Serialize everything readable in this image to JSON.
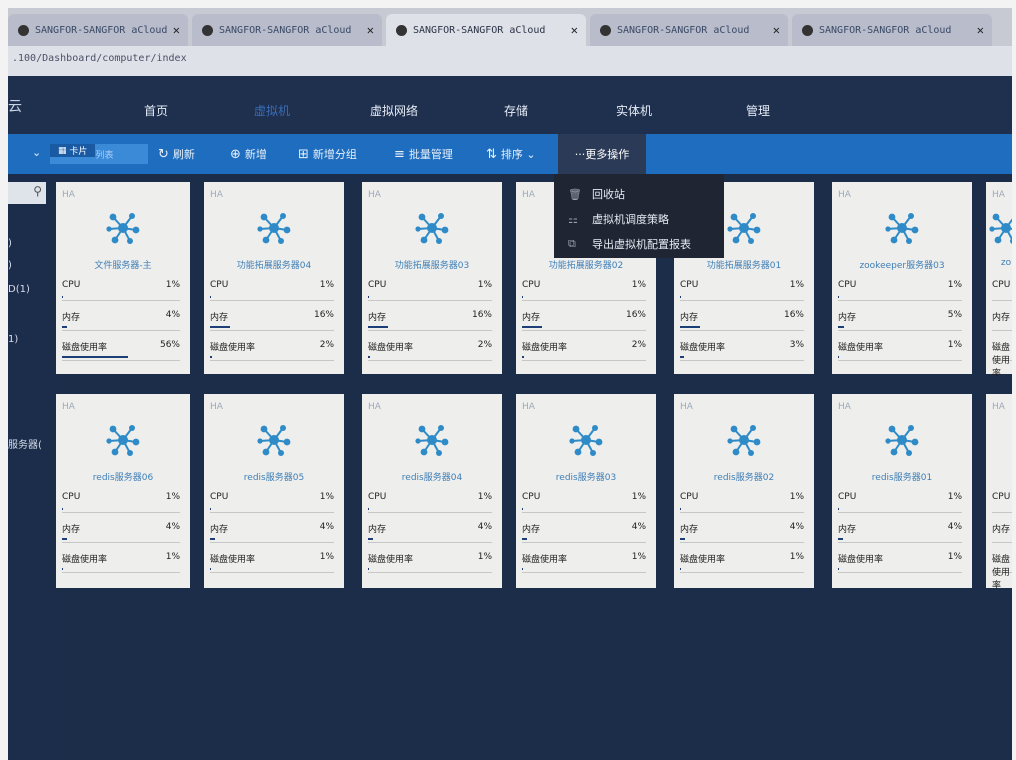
{
  "browser": {
    "tabs": [
      {
        "label": "SANGFOR-SANGFOR aCloud",
        "active": false
      },
      {
        "label": "SANGFOR-SANGFOR aCloud",
        "active": false
      },
      {
        "label": "SANGFOR-SANGFOR aCloud",
        "active": true
      },
      {
        "label": "SANGFOR-SANGFOR aCloud",
        "active": false
      },
      {
        "label": "SANGFOR-SANGFOR aCloud",
        "active": false
      }
    ],
    "url": ".100/Dashboard/computer/index"
  },
  "nav": {
    "brand": "云",
    "items": [
      {
        "label": "首页",
        "active": false
      },
      {
        "label": "虚拟机",
        "active": true
      },
      {
        "label": "虚拟网络",
        "active": false
      },
      {
        "label": "存储",
        "active": false
      },
      {
        "label": "实体机",
        "active": false
      },
      {
        "label": "管理",
        "active": false
      }
    ]
  },
  "toolbar": {
    "view_card": "卡片",
    "view_list": "列表",
    "refresh": "刷新",
    "add": "新增",
    "add_group": "新增分组",
    "batch": "批量管理",
    "sort": "排序",
    "more": "更多操作"
  },
  "sidebar": {
    "items": [
      ")",
      ")",
      "D(1)",
      "1)",
      "服务器("
    ]
  },
  "dropdown": {
    "items": [
      {
        "label": "回收站",
        "icon": "trash-icon"
      },
      {
        "label": "虚拟机调度策略",
        "icon": "schedule-icon"
      },
      {
        "label": "导出虚拟机配置报表",
        "icon": "export-icon"
      }
    ]
  },
  "metric_labels": {
    "cpu": "CPU",
    "mem": "内存",
    "disk": "磁盘使用率"
  },
  "ha_label": "HA",
  "vms_row1": [
    {
      "name": "文件服务器-主",
      "cpu": "1%",
      "mem": "4%",
      "disk": "56%"
    },
    {
      "name": "功能拓展服务器04",
      "cpu": "1%",
      "mem": "16%",
      "disk": "2%"
    },
    {
      "name": "功能拓展服务器03",
      "cpu": "1%",
      "mem": "16%",
      "disk": "2%"
    },
    {
      "name": "功能拓展服务器02",
      "cpu": "1%",
      "mem": "16%",
      "disk": "2%"
    },
    {
      "name": "功能拓展服务器01",
      "cpu": "1%",
      "mem": "16%",
      "disk": "3%"
    },
    {
      "name": "zookeeper服务器03",
      "cpu": "1%",
      "mem": "5%",
      "disk": "1%"
    },
    {
      "name": "zo",
      "cpu": "",
      "mem": "",
      "disk": ""
    }
  ],
  "vms_row2": [
    {
      "name": "redis服务器06",
      "cpu": "1%",
      "mem": "4%",
      "disk": "1%"
    },
    {
      "name": "redis服务器05",
      "cpu": "1%",
      "mem": "4%",
      "disk": "1%"
    },
    {
      "name": "redis服务器04",
      "cpu": "1%",
      "mem": "4%",
      "disk": "1%"
    },
    {
      "name": "redis服务器03",
      "cpu": "1%",
      "mem": "4%",
      "disk": "1%"
    },
    {
      "name": "redis服务器02",
      "cpu": "1%",
      "mem": "4%",
      "disk": "1%"
    },
    {
      "name": "redis服务器01",
      "cpu": "1%",
      "mem": "4%",
      "disk": "1%"
    },
    {
      "name": "",
      "cpu": "",
      "mem": "",
      "disk": ""
    }
  ],
  "colors": {
    "accent": "#1e6dbe",
    "nav_bg": "#1f2f4e",
    "icon": "#2e8bc8",
    "bar": "#1d3f77"
  }
}
